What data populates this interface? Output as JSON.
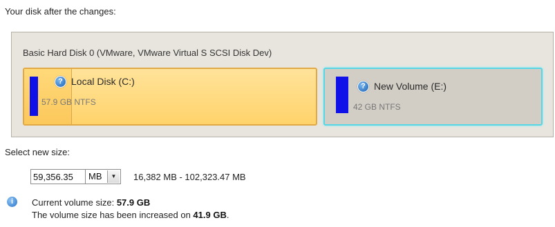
{
  "header": {
    "title": "Your disk after the changes:"
  },
  "disk": {
    "name": "Basic Hard Disk 0 (VMware, VMware Virtual S SCSI Disk Dev)",
    "partitions": [
      {
        "label": "Local Disk (C:)",
        "detail": "57.9 GB NTFS",
        "help_icon": "?"
      },
      {
        "label": "New Volume (E:)",
        "detail": "42 GB NTFS",
        "help_icon": "?"
      }
    ]
  },
  "resize": {
    "label": "Select new size:",
    "value": "59,356.35",
    "unit": "MB",
    "unit_arrow": "▼",
    "range": "16,382 MB - 102,323.47 MB"
  },
  "info": {
    "icon": "i",
    "current_prefix": "Current volume size: ",
    "current_value": "57.9 GB",
    "change_prefix": "The volume size has been increased on ",
    "change_value": "41.9 GB",
    "change_suffix": "."
  }
}
